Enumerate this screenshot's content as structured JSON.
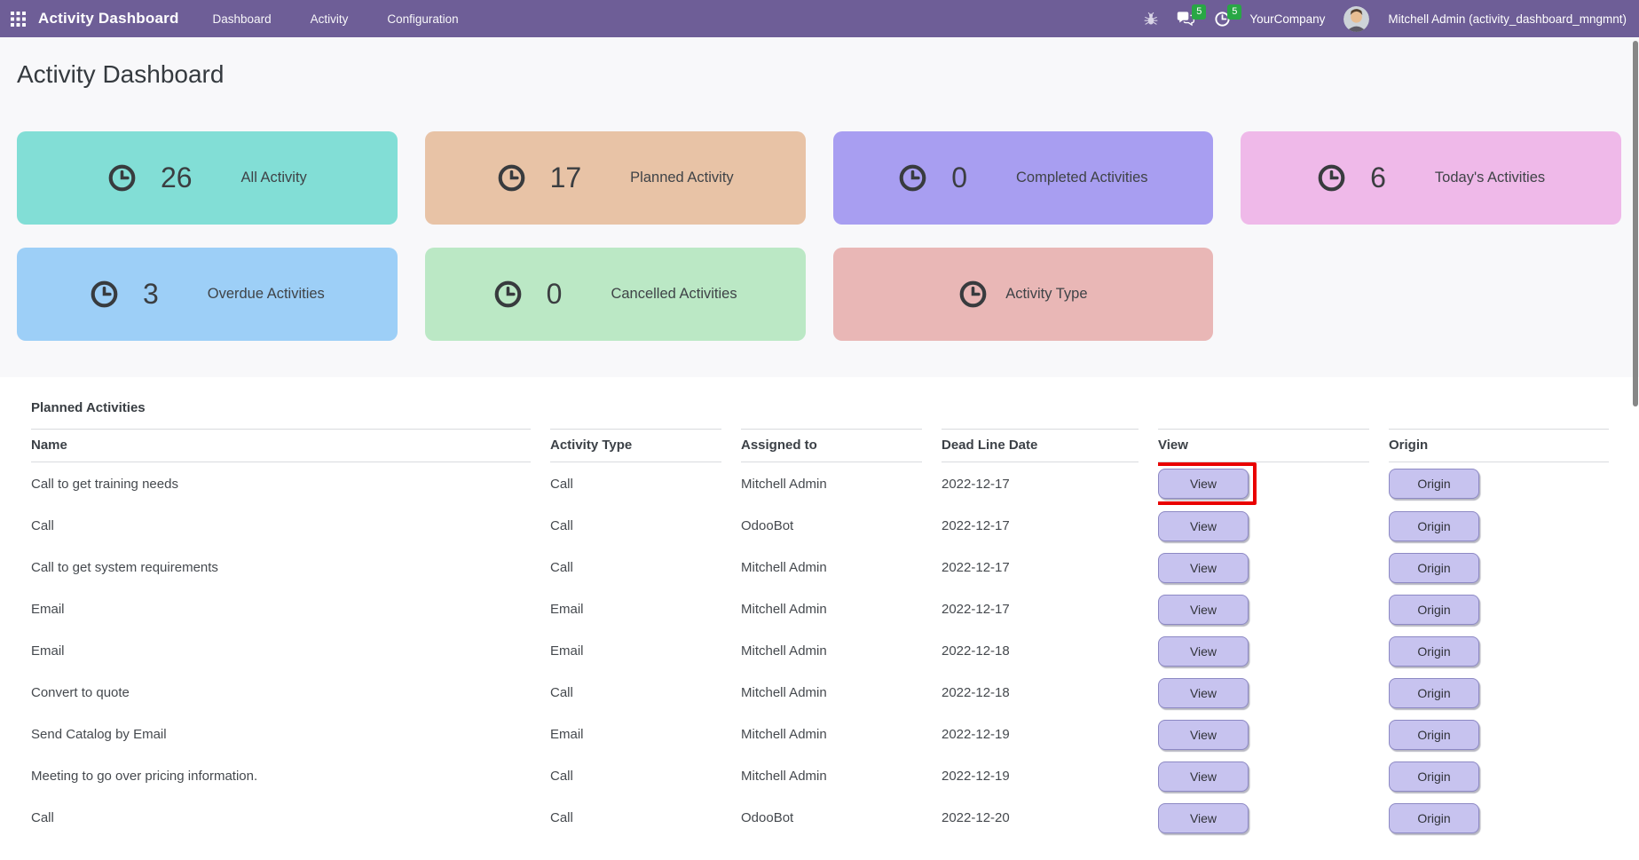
{
  "navbar": {
    "brand": "Activity Dashboard",
    "menus": [
      {
        "id": "dashboard",
        "label": "Dashboard"
      },
      {
        "id": "activity",
        "label": "Activity"
      },
      {
        "id": "configuration",
        "label": "Configuration"
      }
    ],
    "messages_badge": "5",
    "activities_badge": "5",
    "company": "YourCompany",
    "user": "Mitchell Admin (activity_dashboard_mngmnt)",
    "colors": {
      "bg": "#6e5e97",
      "badge": "#28a745"
    }
  },
  "page": {
    "title": "Activity Dashboard"
  },
  "stat_cards": [
    {
      "id": "all-activity",
      "count": "26",
      "label": "All Activity",
      "bg": "#82ded6"
    },
    {
      "id": "planned-activity",
      "count": "17",
      "label": "Planned Activity",
      "bg": "#e8c3a6"
    },
    {
      "id": "completed-activities",
      "count": "0",
      "label": "Completed Activities",
      "bg": "#a89ef1"
    },
    {
      "id": "todays-activities",
      "count": "6",
      "label": "Today's Activities",
      "bg": "#efb9e9"
    },
    {
      "id": "overdue-activities",
      "count": "3",
      "label": "Overdue Activities",
      "bg": "#9dcff7"
    },
    {
      "id": "cancelled-activities",
      "count": "0",
      "label": "Cancelled Activities",
      "bg": "#bbe8c5"
    },
    {
      "id": "activity-type",
      "count": null,
      "label": "Activity Type",
      "bg": "#e9b7b6"
    }
  ],
  "table": {
    "section_title": "Planned Activities",
    "columns": [
      "Name",
      "Activity Type",
      "Assigned to",
      "Dead Line Date",
      "View",
      "Origin"
    ],
    "view_label": "View",
    "origin_label": "Origin",
    "rows": [
      {
        "name": "Call to get training needs",
        "activity_type": "Call",
        "assigned_to": "Mitchell Admin",
        "deadline": "2022-12-17",
        "view_highlighted": true
      },
      {
        "name": "Call",
        "activity_type": "Call",
        "assigned_to": "OdooBot",
        "deadline": "2022-12-17",
        "view_highlighted": false
      },
      {
        "name": "Call to get system requirements",
        "activity_type": "Call",
        "assigned_to": "Mitchell Admin",
        "deadline": "2022-12-17",
        "view_highlighted": false
      },
      {
        "name": "Email",
        "activity_type": "Email",
        "assigned_to": "Mitchell Admin",
        "deadline": "2022-12-17",
        "view_highlighted": false
      },
      {
        "name": "Email",
        "activity_type": "Email",
        "assigned_to": "Mitchell Admin",
        "deadline": "2022-12-18",
        "view_highlighted": false
      },
      {
        "name": "Convert to quote",
        "activity_type": "Call",
        "assigned_to": "Mitchell Admin",
        "deadline": "2022-12-18",
        "view_highlighted": false
      },
      {
        "name": "Send Catalog by Email",
        "activity_type": "Email",
        "assigned_to": "Mitchell Admin",
        "deadline": "2022-12-19",
        "view_highlighted": false
      },
      {
        "name": "Meeting to go over pricing information.",
        "activity_type": "Call",
        "assigned_to": "Mitchell Admin",
        "deadline": "2022-12-19",
        "view_highlighted": false
      },
      {
        "name": "Call",
        "activity_type": "Call",
        "assigned_to": "OdooBot",
        "deadline": "2022-12-20",
        "view_highlighted": false
      }
    ]
  }
}
